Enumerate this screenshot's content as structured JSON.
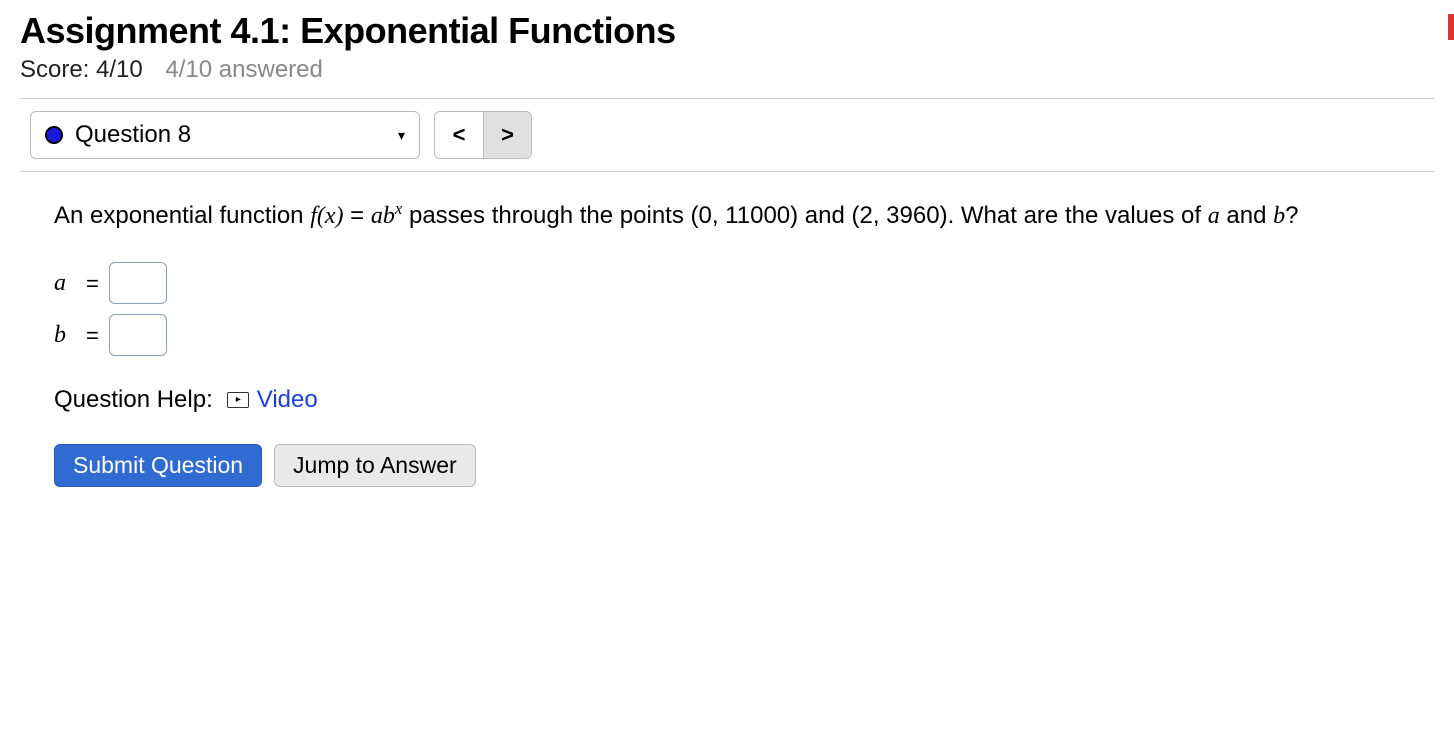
{
  "header": {
    "title": "Assignment 4.1: Exponential Functions",
    "score_label": "Score: 4/10",
    "answered_label": "4/10 answered"
  },
  "nav": {
    "question_label": "Question 8",
    "prev_glyph": "<",
    "next_glyph": ">",
    "caret_glyph": "▾"
  },
  "question": {
    "text_part1": "An exponential function ",
    "fx": "f(x)",
    "eq": " = ",
    "ab": "ab",
    "sup": "x",
    "text_part2": " passes through the points (0, 11000) and (2, 3960). What are the values of ",
    "a_var": "a",
    "and_word": " and ",
    "b_var": "b",
    "qmark": "?"
  },
  "answers": {
    "a_label": "a",
    "b_label": "b",
    "eq_sign": "="
  },
  "help": {
    "label": "Question Help:",
    "video_glyph": "▸",
    "video_text": "Video"
  },
  "buttons": {
    "submit": "Submit Question",
    "jump": "Jump to Answer"
  }
}
